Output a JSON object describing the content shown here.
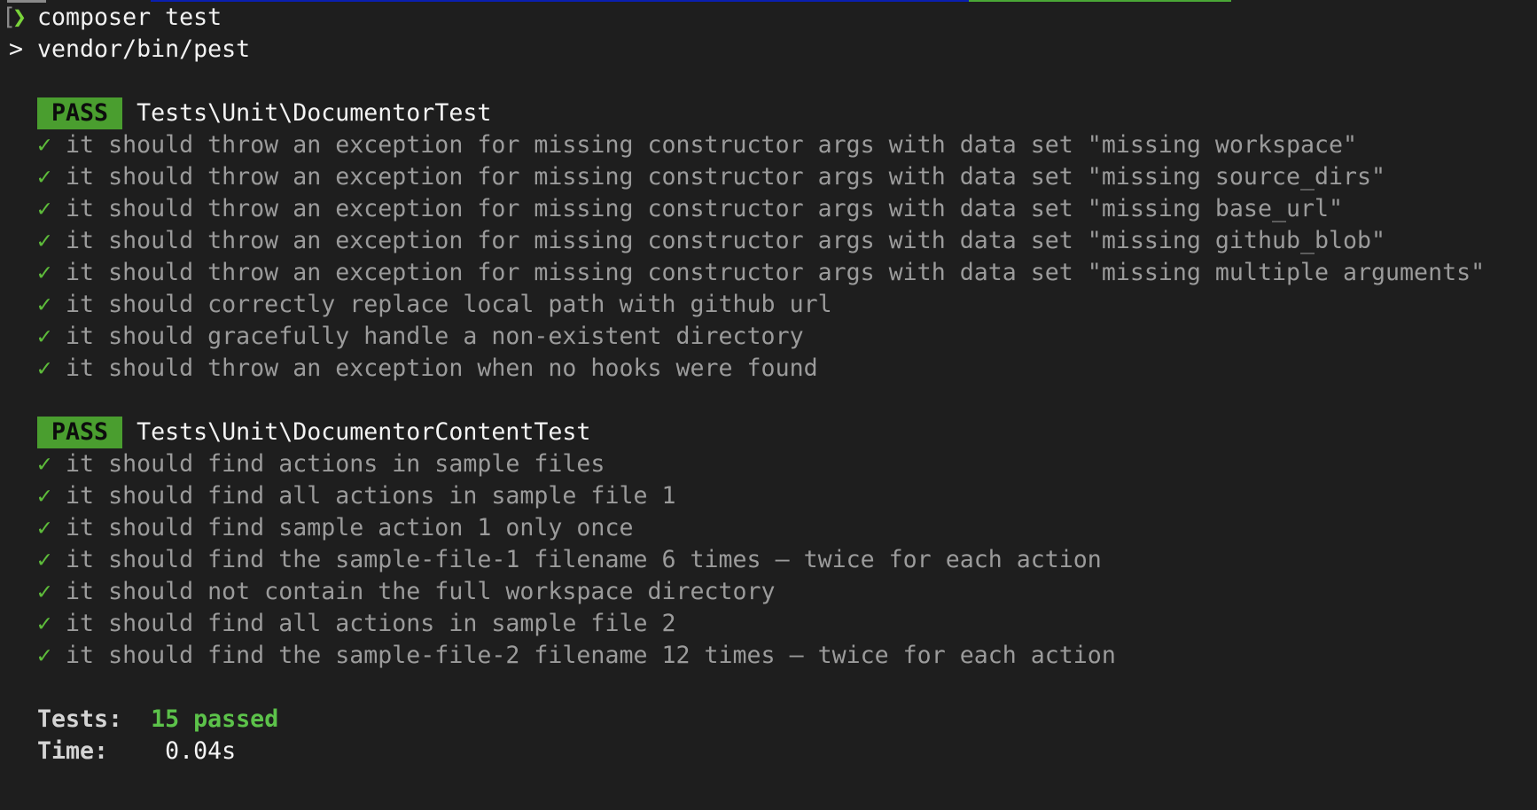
{
  "prompt": {
    "bracket": "[",
    "chevron": "❯",
    "command": "composer test",
    "script_prefix": ">",
    "script": "vendor/bin/pest"
  },
  "colors": {
    "background": "#1e1e1e",
    "pass_badge": "#4a9e2f",
    "check": "#5dbb3a",
    "passed_text": "#5cc24a",
    "test_text": "#9b9b9b"
  },
  "suites": [
    {
      "badge": "PASS",
      "name": "Tests\\Unit\\DocumentorTest",
      "tests": [
        "it should throw an exception for missing constructor args with data set \"missing workspace\"",
        "it should throw an exception for missing constructor args with data set \"missing source_dirs\"",
        "it should throw an exception for missing constructor args with data set \"missing base_url\"",
        "it should throw an exception for missing constructor args with data set \"missing github_blob\"",
        "it should throw an exception for missing constructor args with data set \"missing multiple arguments\"",
        "it should correctly replace local path with github url",
        "it should gracefully handle a non-existent directory",
        "it should throw an exception when no hooks were found"
      ]
    },
    {
      "badge": "PASS",
      "name": "Tests\\Unit\\DocumentorContentTest",
      "tests": [
        "it should find actions in sample files",
        "it should find all actions in sample file 1",
        "it should find sample action 1 only once",
        "it should find the sample-file-1 filename 6 times – twice for each action",
        "it should not contain the full workspace directory",
        "it should find all actions in sample file 2",
        "it should find the sample-file-2 filename 12 times – twice for each action"
      ]
    }
  ],
  "check_icon": "✓",
  "summary": {
    "tests_label": "Tests:",
    "tests_value": "15 passed",
    "time_label": "Time:",
    "time_value": "0.04s"
  }
}
